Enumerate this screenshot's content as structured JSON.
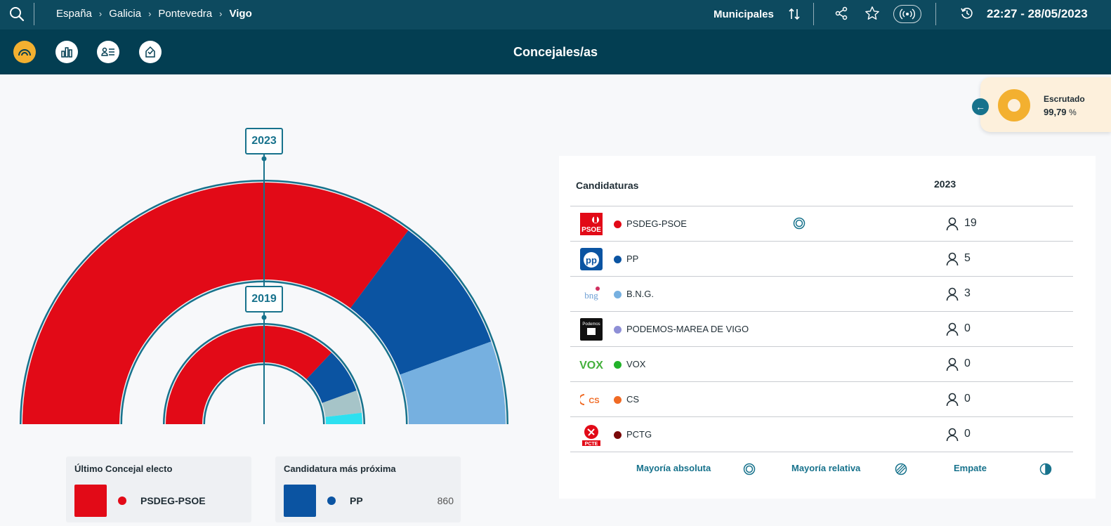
{
  "topbar": {
    "breadcrumb": [
      "España",
      "Galicia",
      "Pontevedra",
      "Vigo"
    ],
    "election_type": "Municipales",
    "datetime": "22:27 - 28/05/2023"
  },
  "subbar": {
    "title": "Concejales/as",
    "nav_icons": [
      "hemicycle-icon",
      "bar-chart-icon",
      "candidates-icon",
      "vote-icon"
    ]
  },
  "escrutado": {
    "label": "Escrutado",
    "value": "99,79",
    "unit": "%"
  },
  "hemicycle": {
    "outer_year": "2023",
    "inner_year": "2019",
    "outer_seats": [
      {
        "party": "PSDEG-PSOE",
        "seats": 19,
        "color": "#e20a17"
      },
      {
        "party": "PP",
        "seats": 5,
        "color": "#0b54a2"
      },
      {
        "party": "B.N.G.",
        "seats": 3,
        "color": "#76b0e0"
      }
    ],
    "inner_seats": [
      {
        "party": "PSDEG-PSOE",
        "seats": 20,
        "color": "#e20a17"
      },
      {
        "party": "PP",
        "seats": 4,
        "color": "#0b54a2"
      },
      {
        "party": "other",
        "seats": 2,
        "color": "#a6c4c8"
      },
      {
        "party": "other-2",
        "seats": 1,
        "color": "#2de0f0"
      }
    ]
  },
  "last_elected": {
    "title": "Último Concejal electo",
    "party": "PSDEG-PSOE",
    "color": "#e20a17"
  },
  "next_candidate": {
    "title": "Candidatura más próxima",
    "party": "PP",
    "votes": "860",
    "color": "#0b54a2"
  },
  "table": {
    "col_candidaturas": "Candidaturas",
    "col_year": "2023",
    "rows": [
      {
        "party": "PSDEG-PSOE",
        "seats": "19",
        "color": "#e20a17",
        "logo": "psoe-logo",
        "logo_text": "PSOE",
        "majority": true
      },
      {
        "party": "PP",
        "seats": "5",
        "color": "#0b54a2",
        "logo": "pp-logo",
        "logo_text": "pp",
        "majority": false
      },
      {
        "party": "B.N.G.",
        "seats": "3",
        "color": "#76b0e0",
        "logo": "bng-logo",
        "logo_text": "bng",
        "majority": false
      },
      {
        "party": "PODEMOS-MAREA DE VIGO",
        "seats": "0",
        "color": "#8e8fd6",
        "logo": "podemos-logo",
        "logo_text": "Podemos",
        "majority": false
      },
      {
        "party": "VOX",
        "seats": "0",
        "color": "#22b22a",
        "logo": "vox-logo",
        "logo_text": "VOX",
        "majority": false
      },
      {
        "party": "CS",
        "seats": "0",
        "color": "#f06a24",
        "logo": "cs-logo",
        "logo_text": "CS",
        "majority": false
      },
      {
        "party": "PCTG",
        "seats": "0",
        "color": "#7a0a0a",
        "logo": "pcte-logo",
        "logo_text": "PCTE",
        "majority": false
      }
    ]
  },
  "legend": {
    "absolute": "Mayoría absoluta",
    "relative": "Mayoría relativa",
    "tie": "Empate"
  }
}
